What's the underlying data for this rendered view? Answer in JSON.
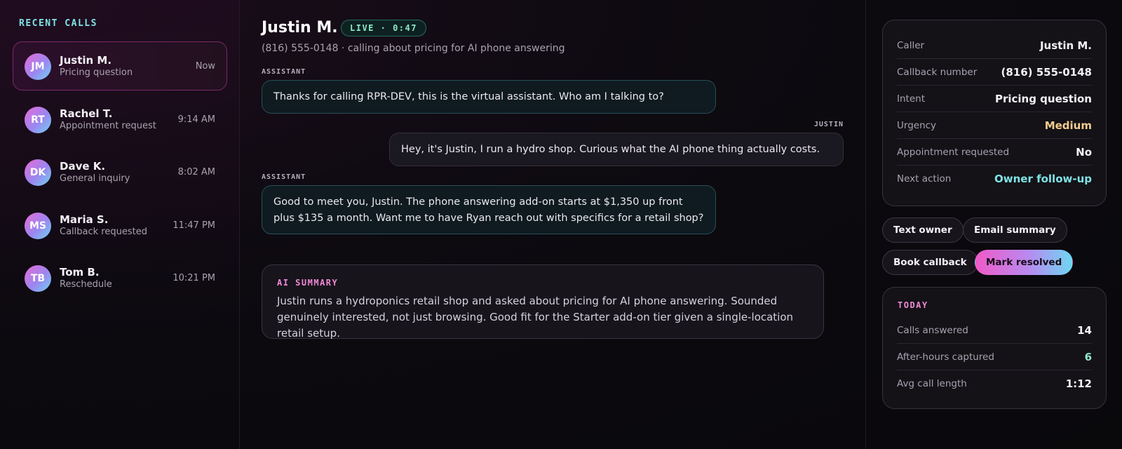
{
  "sidebar": {
    "title": "RECENT CALLS",
    "calls": [
      {
        "initials": "JM",
        "name": "Justin M.",
        "subtitle": "Pricing question",
        "time": "Now"
      },
      {
        "initials": "RT",
        "name": "Rachel T.",
        "subtitle": "Appointment request",
        "time": "9:14 AM"
      },
      {
        "initials": "DK",
        "name": "Dave K.",
        "subtitle": "General inquiry",
        "time": "8:02 AM"
      },
      {
        "initials": "MS",
        "name": "Maria S.",
        "subtitle": "Callback requested",
        "time": "11:47 PM"
      },
      {
        "initials": "TB",
        "name": "Tom B.",
        "subtitle": "Reschedule",
        "time": "10:21 PM"
      }
    ]
  },
  "header": {
    "caller_name": "Justin M.",
    "live_badge": "LIVE · 0:47",
    "subtitle": "(816) 555-0148 · calling about pricing for AI phone answering"
  },
  "transcript": [
    {
      "role": "assistant",
      "label": "ASSISTANT",
      "text": "Thanks for calling RPR-DEV, this is the virtual assistant. Who am I talking to?"
    },
    {
      "role": "user",
      "label": "JUSTIN",
      "text": "Hey, it's Justin, I run a hydro shop. Curious what the AI phone thing actually costs."
    },
    {
      "role": "assistant",
      "label": "ASSISTANT",
      "text": "Good to meet you, Justin. The phone answering add-on starts at $1,350 up front plus $135 a month. Want me to have Ryan reach out with specifics for a retail shop?"
    }
  ],
  "summary": {
    "title": "AI SUMMARY",
    "text": "Justin runs a hydroponics retail shop and asked about pricing for AI phone answering. Sounded genuinely interested, not just browsing. Good fit for the Starter add-on tier given a single-location retail setup."
  },
  "details": [
    {
      "key": "Caller",
      "value": "Justin M."
    },
    {
      "key": "Callback number",
      "value": "(816) 555-0148"
    },
    {
      "key": "Intent",
      "value": "Pricing question"
    },
    {
      "key": "Urgency",
      "value": "Medium"
    },
    {
      "key": "Appointment requested",
      "value": "No"
    },
    {
      "key": "Next action",
      "value": "Owner follow-up"
    }
  ],
  "actions": {
    "text_owner": "Text owner",
    "email_summary": "Email summary",
    "book_callback": "Book callback",
    "mark_resolved": "Mark resolved"
  },
  "today": {
    "title": "TODAY",
    "stats": [
      {
        "key": "Calls answered",
        "value": "14"
      },
      {
        "key": "After-hours captured",
        "value": "6"
      },
      {
        "key": "Avg call length",
        "value": "1:12"
      }
    ]
  },
  "colors": {
    "accent_cyan": "#7FE3E6",
    "accent_pink": "#F08AD8",
    "accent_amber": "#F2CC8F",
    "accent_green": "#8FE7C8"
  }
}
